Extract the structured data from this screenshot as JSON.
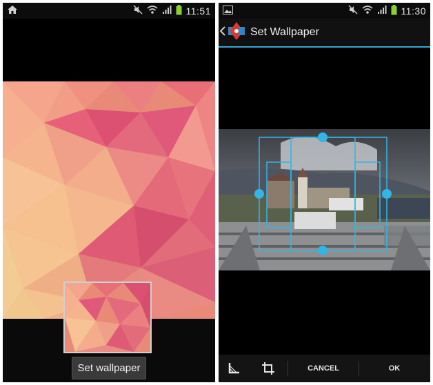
{
  "left_phone": {
    "statusbar": {
      "time": "11:51",
      "icons": [
        "home-icon",
        "mute-icon",
        "wifi-icon",
        "signal-icon",
        "battery-icon"
      ]
    },
    "set_wallpaper_label": "Set wallpaper"
  },
  "right_phone": {
    "statusbar": {
      "time": "11:30",
      "icons": [
        "image-icon",
        "mute-icon",
        "wifi-icon",
        "signal-icon",
        "battery-icon"
      ]
    },
    "actionbar": {
      "title": "Set Wallpaper",
      "icons": [
        "back-chevron-icon",
        "app-icon"
      ]
    },
    "toolbar": {
      "cancel_label": "CANCEL",
      "ok_label": "OK",
      "icons": [
        "aspect-ratio-icon",
        "crop-icon"
      ]
    }
  },
  "colors": {
    "accent": "#33a9d8",
    "battery": "#8bd12a",
    "crop_handle": "#33b5e5"
  }
}
